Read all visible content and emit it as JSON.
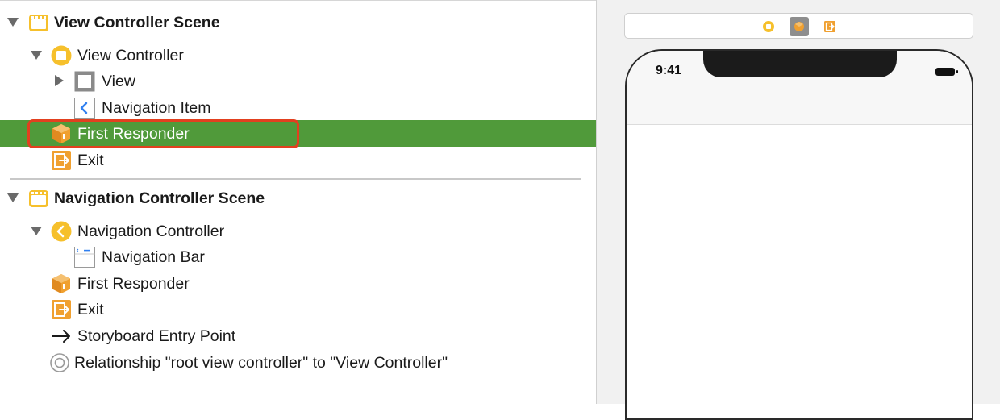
{
  "outline": {
    "items": [
      {
        "label": "View Controller Scene",
        "bold": true,
        "icon": "scene-icon"
      },
      {
        "label": "View Controller",
        "bold": false,
        "icon": "view-controller-icon"
      },
      {
        "label": "View",
        "bold": false,
        "icon": "view-icon"
      },
      {
        "label": "Navigation Item",
        "bold": false,
        "icon": "navigation-item-icon"
      },
      {
        "label": "First Responder",
        "bold": false,
        "icon": "first-responder-icon",
        "selected": true
      },
      {
        "label": "Exit",
        "bold": false,
        "icon": "exit-icon"
      },
      {
        "label": "Navigation Controller Scene",
        "bold": true,
        "icon": "scene-icon"
      },
      {
        "label": "Navigation Controller",
        "bold": false,
        "icon": "navigation-controller-icon"
      },
      {
        "label": "Navigation Bar",
        "bold": false,
        "icon": "navigation-bar-icon"
      },
      {
        "label": "First Responder",
        "bold": false,
        "icon": "first-responder-icon"
      },
      {
        "label": "Exit",
        "bold": false,
        "icon": "exit-icon"
      },
      {
        "label": "Storyboard Entry Point",
        "bold": false,
        "icon": "arrow-right-icon"
      },
      {
        "label": "Relationship \"root view controller\" to \"View Controller\"",
        "bold": false,
        "icon": "relationship-icon"
      }
    ]
  },
  "canvas": {
    "status_time": "9:41",
    "scene_bar_icons": [
      "view-controller-icon",
      "first-responder-icon",
      "exit-icon"
    ]
  },
  "colors": {
    "selection": "#509a3a",
    "highlight": "#e2401f",
    "accent_orange": "#f0a030",
    "accent_yellow": "#f6c02c"
  }
}
